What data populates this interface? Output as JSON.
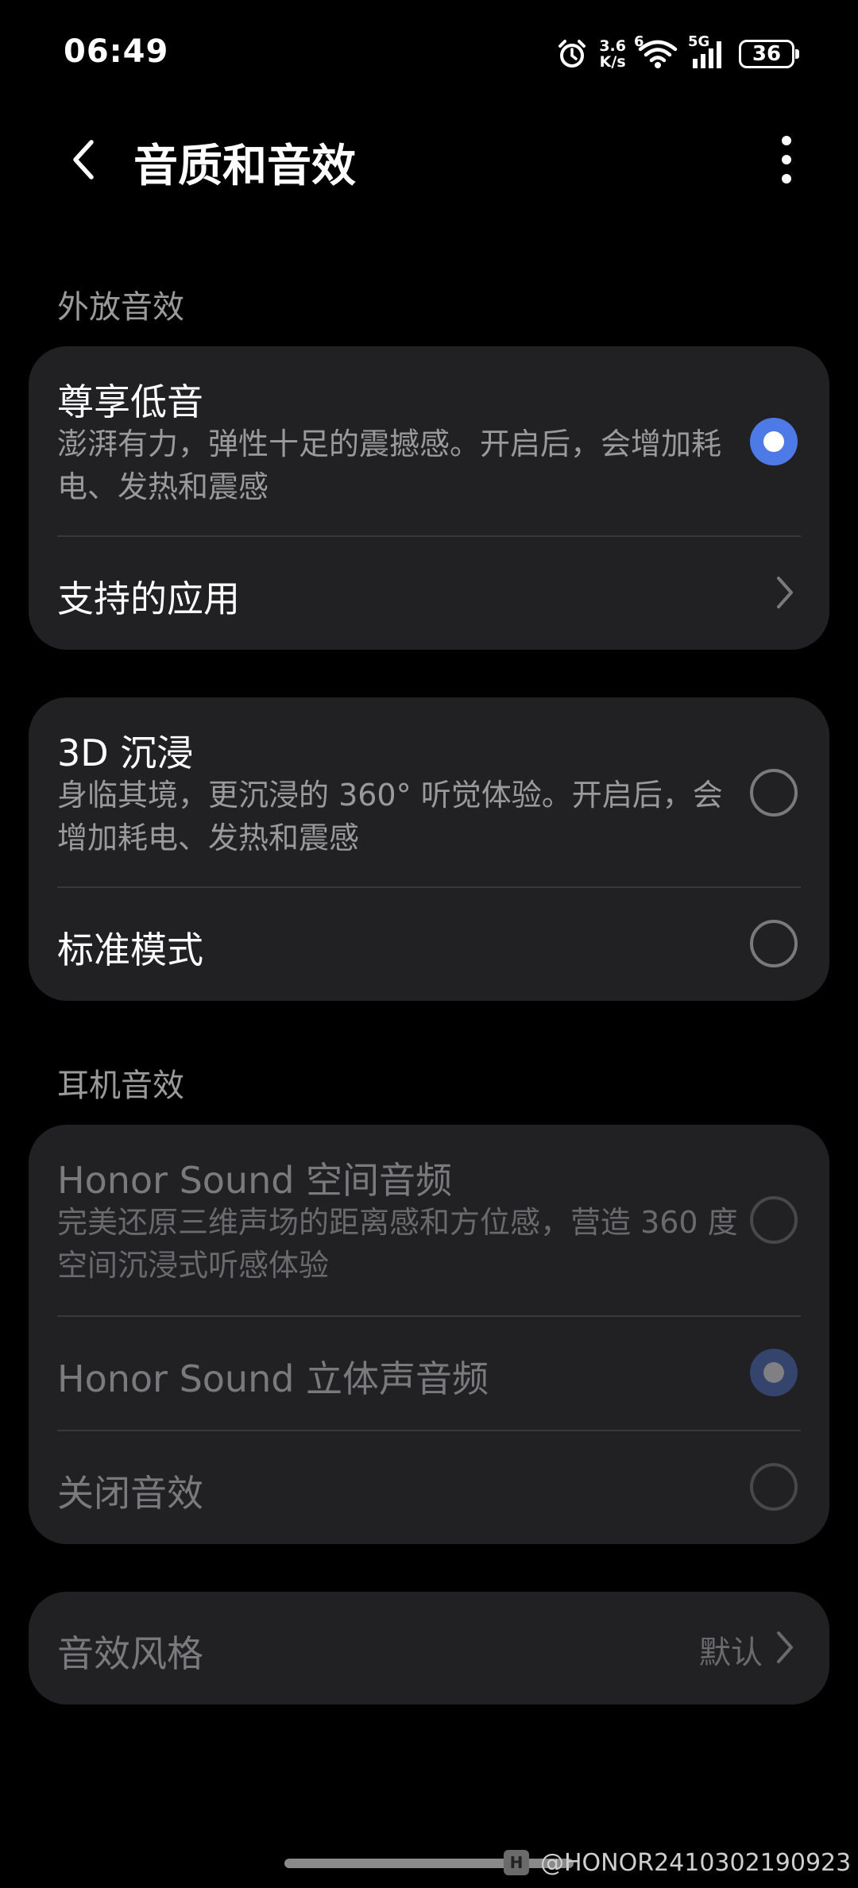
{
  "status_bar": {
    "time": "06:49",
    "net_speed_value": "3.6",
    "net_speed_unit": "K/s",
    "signal_label": "5G",
    "wifi_label": "6",
    "battery": "36"
  },
  "header": {
    "title": "音质和音效"
  },
  "sections": {
    "speaker_label": "外放音效",
    "headphone_label": "耳机音效"
  },
  "speaker_card": {
    "bass": {
      "title": "尊享低音",
      "desc": "澎湃有力，弹性十足的震撼感。开启后，会增加耗电、发热和震感",
      "selected": true
    },
    "supported_apps": {
      "title": "支持的应用"
    }
  },
  "mode_card": {
    "immersive": {
      "title": "3D 沉浸",
      "desc": "身临其境，更沉浸的 360° 听觉体验。开启后，会增加耗电、发热和震感",
      "selected": false
    },
    "standard": {
      "title": "标准模式",
      "selected": false
    }
  },
  "headphone_card": {
    "spatial": {
      "title": "Honor Sound 空间音频",
      "desc": "完美还原三维声场的距离感和方位感，营造 360 度空间沉浸式听感体验",
      "selected": false
    },
    "stereo": {
      "title": "Honor Sound 立体声音频",
      "selected": true
    },
    "off": {
      "title": "关闭音效",
      "selected": false
    }
  },
  "style_card": {
    "title": "音效风格",
    "value": "默认"
  },
  "watermark": {
    "logo": "H",
    "text": "@HONOR2410302190923"
  },
  "colors": {
    "accent": "#4e7ae8",
    "card_bg": "#212124",
    "background": "#000000"
  }
}
